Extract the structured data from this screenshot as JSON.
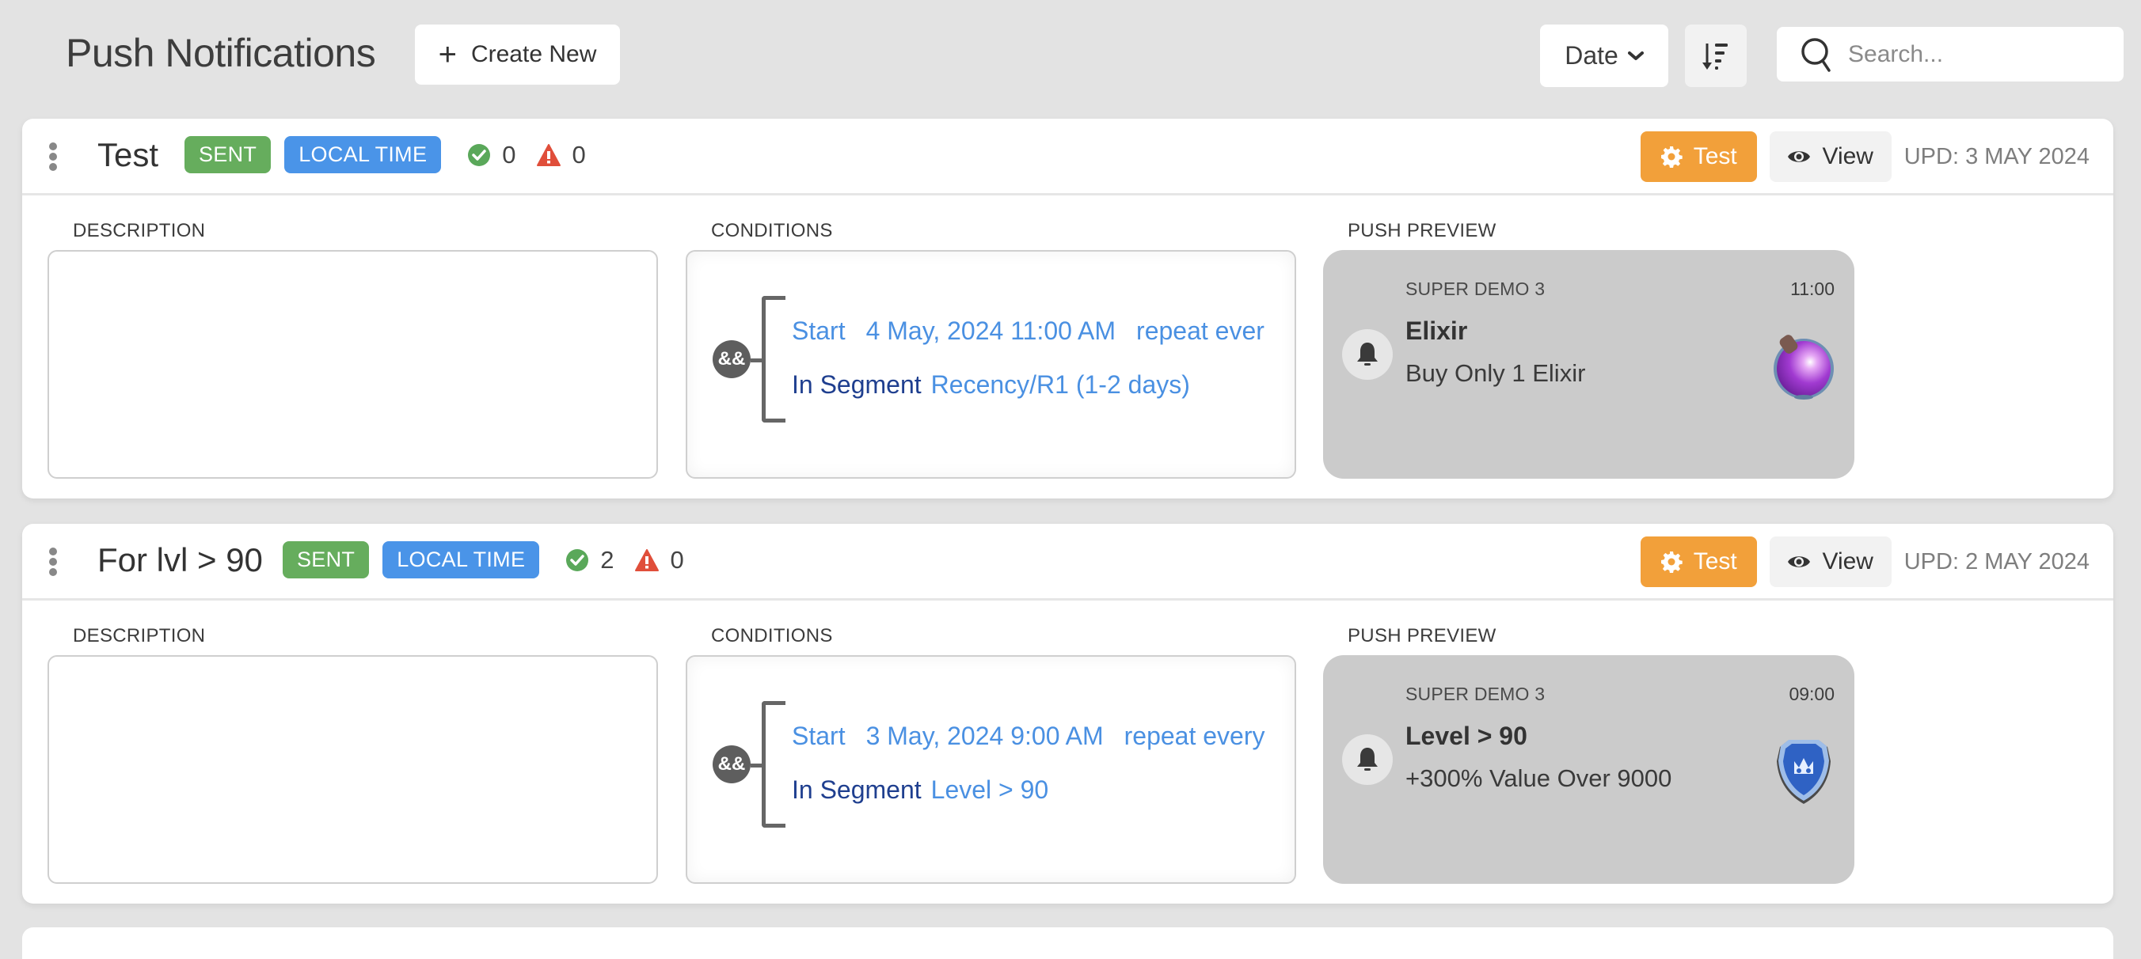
{
  "header": {
    "title": "Push Notifications",
    "create_button_label": "Create New",
    "create_icon": "plus-icon",
    "sort_field": "Date",
    "sort_dropdown_icon": "chevron-down-icon",
    "sort_direction_icon": "sort-descending-icon",
    "search_placeholder": "Search...",
    "search_value": "",
    "search_icon": "search-icon"
  },
  "section_labels": {
    "description": "DESCRIPTION",
    "conditions": "CONDITIONS",
    "push_preview": "PUSH PREVIEW"
  },
  "colors": {
    "sent_badge": "#66ad5d",
    "local_time_badge": "#4a94e8",
    "test_button": "#f2a03a",
    "link_blue": "#4a90e2",
    "segment_label": "#1f3f8f",
    "success_icon": "#5aa85a",
    "warning_icon": "#e04e3a",
    "preview_bg": "#cbcbcb",
    "page_bg": "#e3e3e3"
  },
  "notifications": [
    {
      "title": "Test",
      "status_badge": "SENT",
      "time_badge": "LOCAL TIME",
      "success_count": "0",
      "warning_count": "0",
      "test_button_label": "Test",
      "view_button_label": "View",
      "updated": "UPD: 3 MAY 2024",
      "description": "",
      "conditions": {
        "operator": "&&",
        "start_label": "Start",
        "start_value": "4 May, 2024 11:00 AM",
        "repeat_label": "repeat ever",
        "segment_label": "In Segment",
        "segment_value": "Recency/R1 (1-2 days)"
      },
      "preview": {
        "app_name": "SUPER DEMO 3",
        "time": "11:00",
        "title": "Elixir",
        "body": "Buy Only 1 Elixir",
        "image": "elixir-potion-icon"
      }
    },
    {
      "title": "For lvl > 90",
      "status_badge": "SENT",
      "time_badge": "LOCAL TIME",
      "success_count": "2",
      "warning_count": "0",
      "test_button_label": "Test",
      "view_button_label": "View",
      "updated": "UPD: 2 MAY 2024",
      "description": "",
      "conditions": {
        "operator": "&&",
        "start_label": "Start",
        "start_value": "3 May, 2024 9:00 AM",
        "repeat_label": "repeat every",
        "segment_label": "In Segment",
        "segment_value": "Level > 90"
      },
      "preview": {
        "app_name": "SUPER DEMO 3",
        "time": "09:00",
        "title": "Level > 90",
        "body": "+300% Value Over 9000",
        "image": "blue-shield-crown-icon"
      }
    }
  ]
}
